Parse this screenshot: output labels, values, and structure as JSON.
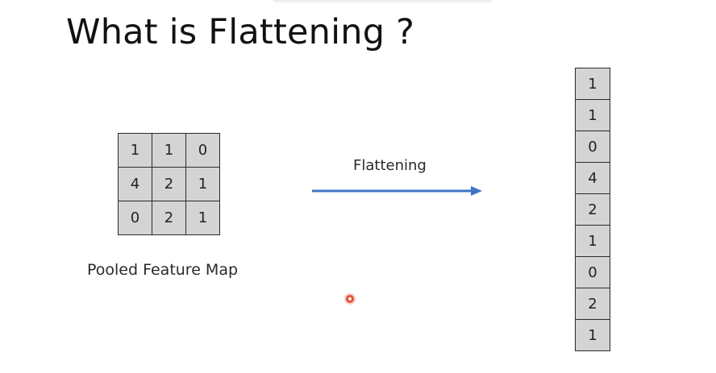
{
  "slide": {
    "title": "What is Flattening ?"
  },
  "pooled_feature_map": {
    "caption": "Pooled Feature Map",
    "rows": [
      [
        "1",
        "1",
        "0"
      ],
      [
        "4",
        "2",
        "1"
      ],
      [
        "0",
        "2",
        "1"
      ]
    ]
  },
  "transform": {
    "label": "Flattening",
    "arrow_color": "#3f74c6"
  },
  "flattened_vector": {
    "values": [
      "1",
      "1",
      "0",
      "4",
      "2",
      "1",
      "0",
      "2",
      "1"
    ]
  },
  "colors": {
    "cell_fill": "#d4d4d4",
    "cell_border": "#2a2a2a",
    "pointer": "#e8503a"
  }
}
